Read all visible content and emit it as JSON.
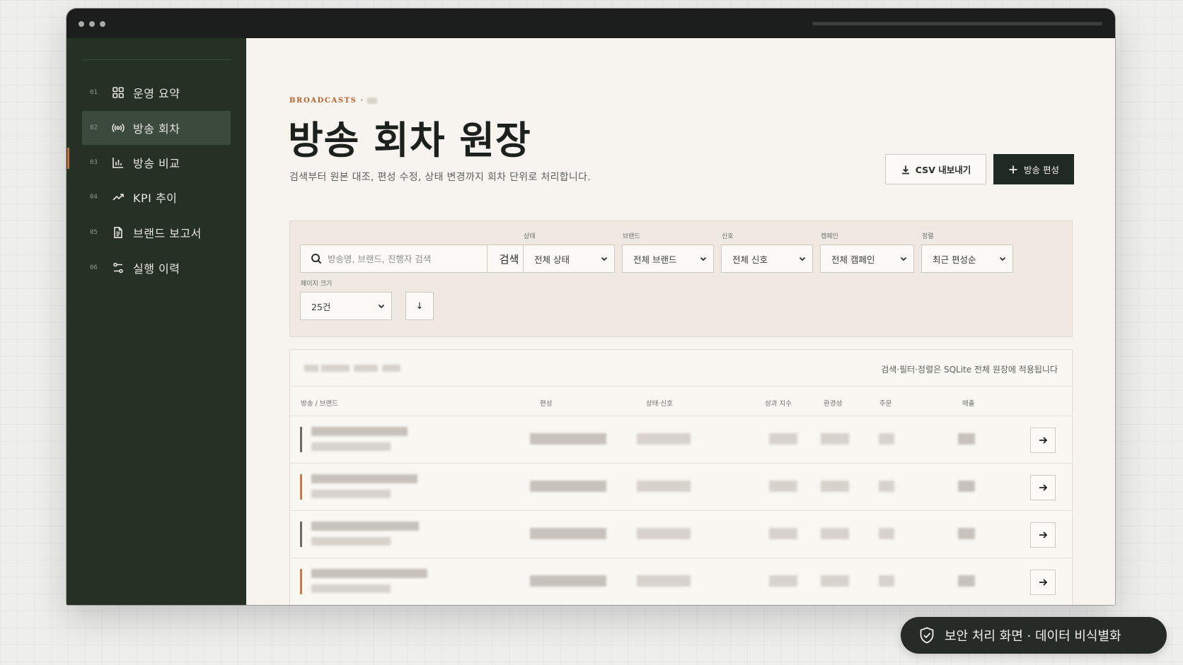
{
  "sidebar": {
    "items": [
      {
        "num": "01",
        "label": "운영 요약",
        "icon": "grid-icon"
      },
      {
        "num": "02",
        "label": "방송 회차",
        "icon": "broadcast-icon",
        "active": true
      },
      {
        "num": "03",
        "label": "방송 비교",
        "icon": "bar-chart-icon"
      },
      {
        "num": "04",
        "label": "KPI 추이",
        "icon": "trend-icon"
      },
      {
        "num": "05",
        "label": "브랜드 보고서",
        "icon": "document-icon"
      },
      {
        "num": "06",
        "label": "실행 이력",
        "icon": "history-icon"
      }
    ]
  },
  "header": {
    "eyebrow": "BROADCASTS ·",
    "title": "방송 회차 원장",
    "subtitle": "검색부터 원본 대조, 편성 수정, 상태 변경까지 회차 단위로 처리합니다.",
    "csv_label": "CSV 내보내기",
    "add_label": "방송 편성"
  },
  "filters": {
    "search_placeholder": "방송명, 브랜드, 진행자 검색",
    "search_button": "검색",
    "status": {
      "label": "상태",
      "value": "전체 상태"
    },
    "brand": {
      "label": "브랜드",
      "value": "전체 브랜드"
    },
    "signal": {
      "label": "신호",
      "value": "전체 신호"
    },
    "campaign": {
      "label": "캠페인",
      "value": "전체 캠페인"
    },
    "sort": {
      "label": "정렬",
      "value": "최근 편성순"
    },
    "page_size": {
      "label": "페이지 크기",
      "value": "25건"
    },
    "sort_direction": "↓"
  },
  "table": {
    "note": "검색·필터·정렬은 SQLite 전체 원장에 적용됩니다",
    "columns": [
      "방송 / 브랜드",
      "편성",
      "상태·신호",
      "성과 지수",
      "환경성",
      "주문",
      "매출"
    ],
    "row_accents": [
      "#6b6b66",
      "#c97a4a",
      "#6b6b66",
      "#c97a4a"
    ]
  },
  "badge": {
    "text": "보안 처리 화면 · 데이터 비식별화"
  }
}
